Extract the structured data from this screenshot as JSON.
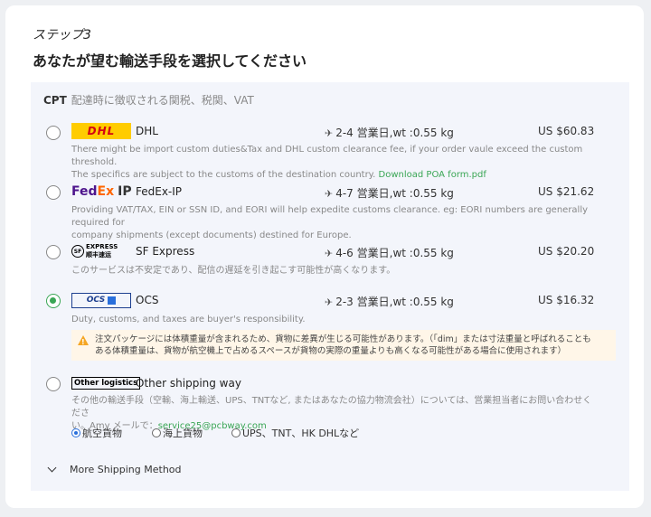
{
  "header": {
    "step": "ステップ3",
    "title": "あなたが望む輸送手段を選択してください"
  },
  "section": {
    "cpt_label": "CPT",
    "cpt_note": "配達時に徴収される関税、税関、VAT"
  },
  "options": [
    {
      "logo_text": "DHL",
      "name": "DHL",
      "eta": "2-4 営業日,wt :0.55 kg",
      "price": "US $60.83",
      "desc1": "There might be import custom duties&Tax and DHL custom clearance fee, if your order vaule exceed the custom threshold.",
      "desc2": "The specifics are subject to the customs of the destination country. ",
      "link": "Download POA form.pdf",
      "selected": false
    },
    {
      "logo_fed": "Fed",
      "logo_ex": "Ex",
      "logo_ip": "IP",
      "name": "FedEx-IP",
      "eta": "4-7 営業日,wt :0.55 kg",
      "price": "US $21.62",
      "desc1": "Providing VAT/TAX, EIN or SSN ID, and EORI will help expedite customs clearance. eg: EORI numbers are generally required for",
      "desc2": "company shipments (except documents) destined for Europe.",
      "selected": false
    },
    {
      "logo_circle": "SF",
      "logo_top": "EXPRESS",
      "logo_bottom": "顺丰速运",
      "name": "SF Express",
      "eta": "4-6 営業日,wt :0.55 kg",
      "price": "US $20.20",
      "desc1": "このサービスは不安定であり、配信の遅延を引き起こす可能性が高くなります。",
      "selected": false
    },
    {
      "logo_text": "OCS",
      "name": "OCS",
      "eta": "2-3 営業日,wt :0.55 kg",
      "price": "US $16.32",
      "desc1": "Duty, customs, and taxes are buyer's responsibility.",
      "warning1": "注文パッケージには体積重量が含まれるため、貨物に差異が生じる可能性があります。（「dim」または寸法重量と呼ばれることも",
      "warning2": "ある体積重量は、貨物が航空機上で占めるスペースが貨物の実際の重量よりも高くなる可能性がある場合に使用されます）",
      "selected": true
    },
    {
      "logo_text": "Other logistics",
      "name": "Other shipping way",
      "desc1": "その他の輸送手段（空輸、海上輸送、UPS、TNTなど, またはあなたの協力物流会社）については、営業担当者にお問い合わせくださ",
      "desc2_prefix": "い。Amy メールで：",
      "email": "service25@pcbway.com",
      "selected": false
    }
  ],
  "sub_options": [
    "航空貨物",
    "海上貨物",
    "UPS、TNT、HK DHLなど"
  ],
  "more": "More Shipping Method",
  "plane_glyph": "✈",
  "colors": {
    "accent": "#3aa655",
    "dhl_yellow": "#ffcc00",
    "dhl_red": "#d40511",
    "warning_bg": "#fff6e8"
  }
}
